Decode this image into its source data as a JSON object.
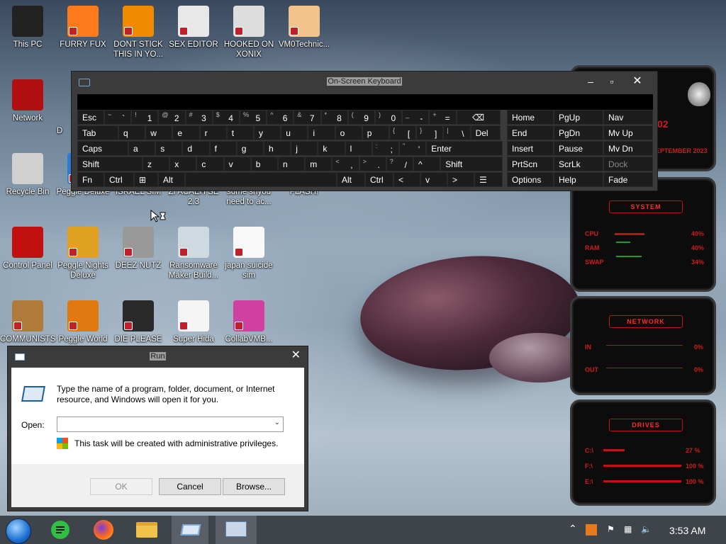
{
  "desktop": {
    "icons": [
      {
        "label": "This PC"
      },
      {
        "label": "FURRY FUX"
      },
      {
        "label": "DONT STICK THIS IN YO..."
      },
      {
        "label": "SEX EDITOR"
      },
      {
        "label": "HOOKED ON XONIX"
      },
      {
        "label": "VM0Technic..."
      },
      {
        "label": "Network"
      },
      {
        "label": "Recycle Bin"
      },
      {
        "label": "Peggle Deluxe"
      },
      {
        "label": "ISRAEL SIM"
      },
      {
        "label": "ZI ACAEH SE 2.3"
      },
      {
        "label": "some shyou need to ac..."
      },
      {
        "label": "FLASH!"
      },
      {
        "label": "Control Panel"
      },
      {
        "label": "Peggle Nights Deluxe"
      },
      {
        "label": "DEEZ NUTZ"
      },
      {
        "label": "Ransomware Maker Build..."
      },
      {
        "label": "japan suicide sim"
      },
      {
        "label": "COMMUNISTS"
      },
      {
        "label": "Peggle World"
      },
      {
        "label": "DIE PLEASE"
      },
      {
        "label": "Super Hida"
      },
      {
        "label": "CollabVMB..."
      }
    ],
    "partial_label": "D"
  },
  "osk": {
    "title": "On-Screen Keyboard",
    "row1": [
      {
        "sh": "",
        "mn": "Esc"
      },
      {
        "sh": "~",
        "mn": "`"
      },
      {
        "sh": "!",
        "mn": "1"
      },
      {
        "sh": "@",
        "mn": "2"
      },
      {
        "sh": "#",
        "mn": "3"
      },
      {
        "sh": "$",
        "mn": "4"
      },
      {
        "sh": "%",
        "mn": "5"
      },
      {
        "sh": "^",
        "mn": "6"
      },
      {
        "sh": "&",
        "mn": "7"
      },
      {
        "sh": "*",
        "mn": "8"
      },
      {
        "sh": "(",
        "mn": "9"
      },
      {
        "sh": ")",
        "mn": "0"
      },
      {
        "sh": "_",
        "mn": "-"
      },
      {
        "sh": "+",
        "mn": "="
      },
      {
        "sh": "",
        "mn": "⌫"
      }
    ],
    "row2": [
      "Tab",
      "q",
      "w",
      "e",
      "r",
      "t",
      "y",
      "u",
      "i",
      "o",
      "p",
      "[",
      "]",
      "\\",
      "Del"
    ],
    "row2_shift": [
      "",
      "",
      "",
      "",
      "",
      "",
      "",
      "",
      "",
      "",
      "",
      "{",
      "}",
      "|",
      ""
    ],
    "row3": [
      "Caps",
      "a",
      "s",
      "d",
      "f",
      "g",
      "h",
      "j",
      "k",
      "l",
      ";",
      "'",
      "Enter"
    ],
    "row3_shift": [
      "",
      "",
      "",
      "",
      "",
      "",
      "",
      "",
      "",
      "",
      ":",
      "\"",
      ""
    ],
    "row4": [
      "Shift",
      "z",
      "x",
      "c",
      "v",
      "b",
      "n",
      "m",
      ",",
      ".",
      "/",
      "^",
      "Shift"
    ],
    "row4_shift": [
      "",
      "",
      "",
      "",
      "",
      "",
      "",
      "",
      "<",
      ">",
      "?",
      "",
      ""
    ],
    "row5": [
      "Fn",
      "Ctrl",
      "⊞",
      "Alt",
      "",
      "Alt",
      "Ctrl",
      "<",
      "v",
      ">",
      "☰"
    ],
    "nav": [
      [
        "Home",
        "PgUp",
        "Nav"
      ],
      [
        "End",
        "PgDn",
        "Mv Up"
      ],
      [
        "Insert",
        "Pause",
        "Mv Dn"
      ],
      [
        "PrtScn",
        "ScrLk",
        "Dock"
      ],
      [
        "Options",
        "Help",
        "Fade"
      ]
    ]
  },
  "gadget": {
    "system_label": "SYSTEM",
    "network_label": "NETWORK",
    "drives_label": "DRIVES",
    "time_partial": "02",
    "date_partial": "SEPTEMBER 2023",
    "system_rows": [
      {
        "name": "CPU",
        "value": "40%"
      },
      {
        "name": "RAM",
        "value": "40%"
      },
      {
        "name": "SWAP",
        "value": "34%"
      }
    ],
    "network_rows": [
      {
        "name": "IN",
        "value": "0%"
      },
      {
        "name": "OUT",
        "value": "0%"
      }
    ],
    "drives_rows": [
      {
        "name": "C:\\",
        "value": "27 %"
      },
      {
        "name": "F:\\",
        "value": "100 %"
      },
      {
        "name": "E:\\",
        "value": "100 %"
      }
    ]
  },
  "run": {
    "title": "Run",
    "message": "Type the name of a program, folder, document, or Internet resource, and Windows will open it for you.",
    "open_label": "Open:",
    "open_value": "",
    "admin_note": "This task will be created with administrative privileges.",
    "ok": "OK",
    "cancel": "Cancel",
    "browse": "Browse..."
  },
  "taskbar": {
    "clock": "3:53 AM"
  },
  "colors": {
    "accent_red": "#d01c1c",
    "taskbar": "#3f434a",
    "osk_bg": "#3b3b3b",
    "osk_key": "#1d1d1d"
  }
}
